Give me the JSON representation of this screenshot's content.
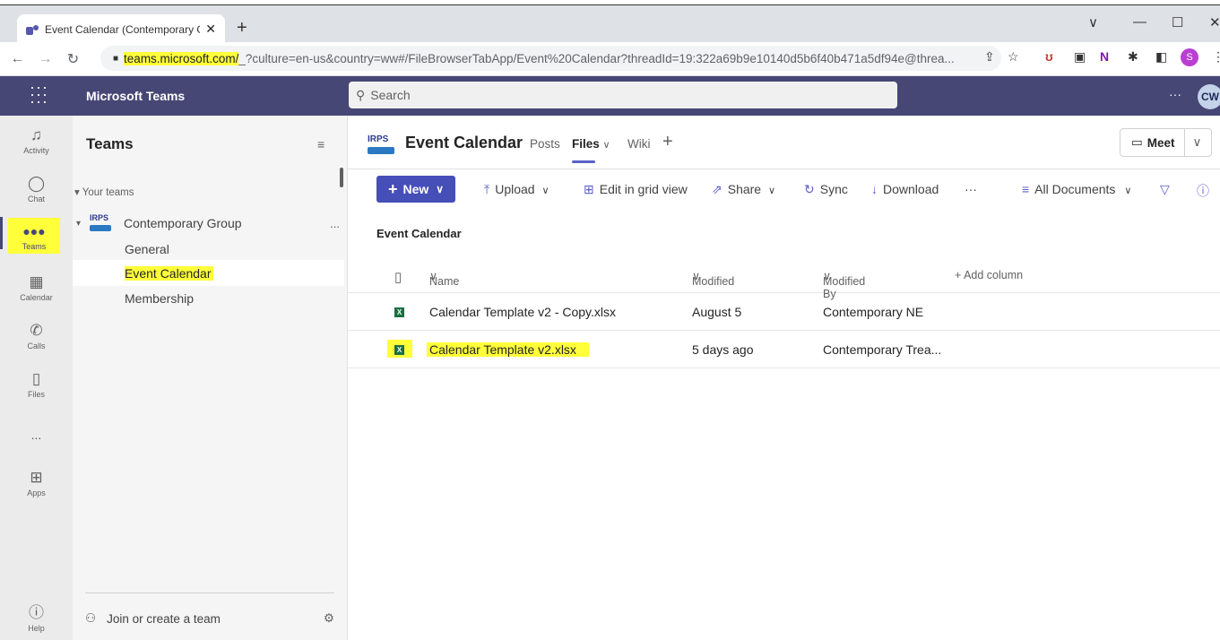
{
  "browser": {
    "tab_title": "Event Calendar (Contemporary G",
    "tab_close": "✕",
    "new_tab": "+",
    "url_domain": "teams.microsoft.com/",
    "url_rest": "_?culture=en-us&country=ww#/FileBrowserTabApp/Event%20Calendar?threadId=19:322a69b9e10140d5b6f40b471a5df94e@threa...",
    "profile_initial": "S"
  },
  "header": {
    "app_name": "Microsoft Teams",
    "search_placeholder": "Search",
    "avatar_initials": "CW"
  },
  "rail": {
    "items": [
      {
        "label": "Activity",
        "icon": "bell-icon"
      },
      {
        "label": "Chat",
        "icon": "chat-icon"
      },
      {
        "label": "Teams",
        "icon": "teams-icon"
      },
      {
        "label": "Calendar",
        "icon": "calendar-icon"
      },
      {
        "label": "Calls",
        "icon": "phone-icon"
      },
      {
        "label": "Files",
        "icon": "file-icon"
      },
      {
        "label": "Apps",
        "icon": "apps-icon"
      },
      {
        "label": "Help",
        "icon": "help-icon"
      }
    ],
    "more": "..."
  },
  "teams_pane": {
    "title": "Teams",
    "section_label": "Your teams",
    "team_name": "Contemporary Group",
    "team_logo_text": "IRPS",
    "team_more": "...",
    "channels": [
      "General",
      "Event Calendar",
      "Membership"
    ],
    "join_label": "Join or create a team"
  },
  "channel": {
    "logo_text": "IRPS",
    "title": "Event Calendar",
    "tabs": [
      "Posts",
      "Files",
      "Wiki"
    ],
    "add_tab": "+",
    "meet_label": "Meet"
  },
  "toolbar": {
    "new_label": "New",
    "upload_label": "Upload",
    "grid_label": "Edit in grid view",
    "share_label": "Share",
    "sync_label": "Sync",
    "download_label": "Download",
    "more": "···",
    "view_label": "All Documents"
  },
  "library": {
    "location": "Event Calendar",
    "columns": {
      "name": "Name",
      "modified": "Modified",
      "modified_by": "Modified By",
      "add_column": "+ Add column"
    },
    "rows": [
      {
        "name": "Calendar Template v2 - Copy.xlsx",
        "modified": "August 5",
        "modified_by": "Contemporary NE"
      },
      {
        "name": "Calendar Template v2.xlsx",
        "modified": "5 days ago",
        "modified_by": "Contemporary Trea..."
      }
    ]
  }
}
